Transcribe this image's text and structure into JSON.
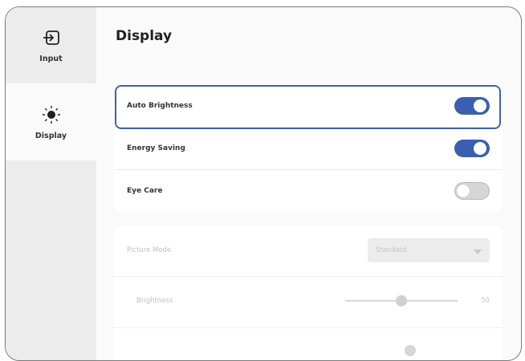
{
  "sidebar": {
    "items": [
      {
        "label": "Input",
        "icon": "input-icon",
        "selected": false
      },
      {
        "label": "Display",
        "icon": "brightness-icon",
        "selected": true
      }
    ]
  },
  "main": {
    "title": "Display",
    "toggles": [
      {
        "label": "Auto Brightness",
        "on": true,
        "focused": true
      },
      {
        "label": "Energy Saving",
        "on": true,
        "focused": false
      },
      {
        "label": "Eye Care",
        "on": false,
        "focused": false
      }
    ],
    "picture_mode": {
      "label": "Picture Mode",
      "value": "Standard",
      "disabled": true
    },
    "brightness": {
      "label": "Brightness",
      "value": "50",
      "fraction": 0.5,
      "disabled": true
    }
  },
  "colors": {
    "accent": "#3b5fb0",
    "focus": "#3f62ac",
    "sidebar_bg": "#ececec",
    "toggle_off": "#d6d6d6"
  }
}
